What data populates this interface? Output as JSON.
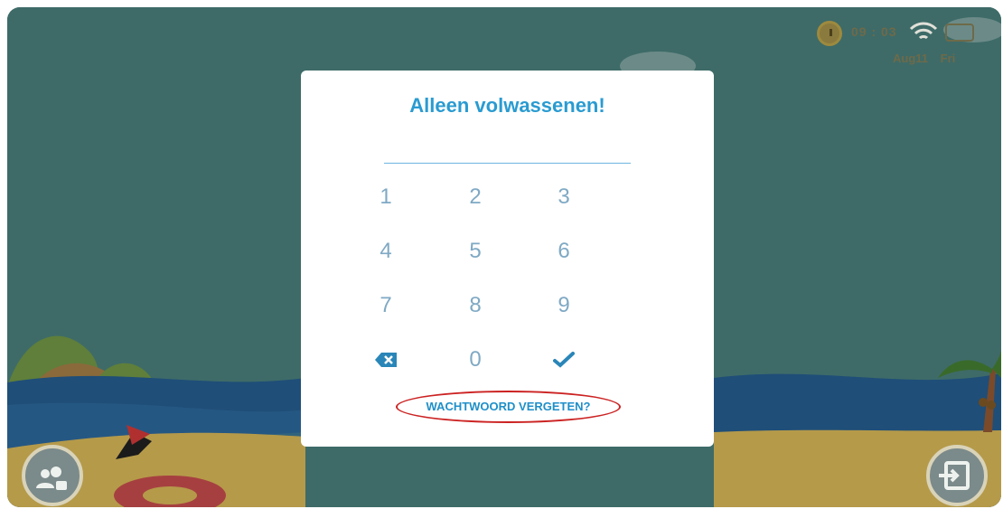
{
  "status": {
    "time": "09 : 03",
    "date": "Aug11 Fri"
  },
  "dialog": {
    "title": "Alleen volwassenen!",
    "keys": [
      "1",
      "2",
      "3",
      "4",
      "5",
      "6",
      "7",
      "8",
      "9",
      "0"
    ],
    "forgot": "WACHTWOORD VERGETEN?"
  },
  "colors": {
    "accent": "#2a9bd1",
    "annotation": "#cc2222"
  },
  "icons": {
    "status": [
      "clock-icon",
      "wifi-icon",
      "battery-icon"
    ],
    "keypad": [
      "backspace-icon",
      "checkmark-icon"
    ],
    "corner_buttons": [
      "parental-lock-icon",
      "exit-icon"
    ]
  }
}
